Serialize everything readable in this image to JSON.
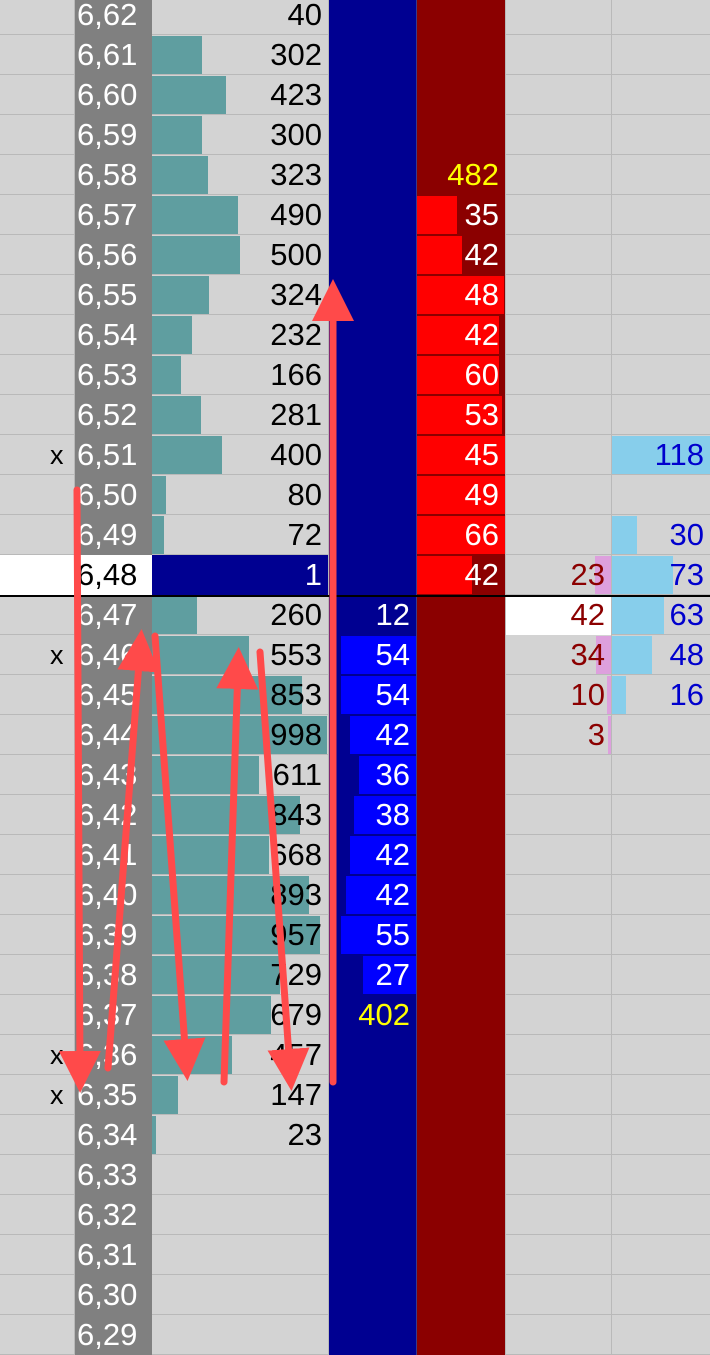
{
  "colors": {
    "sheet_bg": "#d3d3d3",
    "price_bg": "#808080",
    "volume_bar": "#5f9ea0",
    "bid_bg": "#000091",
    "bid_bar": "#0000ff",
    "ask_bg": "#8b0000",
    "ask_bar": "#ff0000",
    "highlight_text": "#ffff00",
    "delta_sell_text": "#8b0000",
    "delta_sell_bar": "#dda0dd",
    "delta_buy_text": "#0000cd",
    "delta_buy_bar": "#87ceeb",
    "arrow": "#ff4a4a"
  },
  "ladder": {
    "rows": [
      {
        "price": "6,62",
        "volume": "40",
        "volume_level": 0.0,
        "bid": "",
        "ask": "",
        "sell_delta": "",
        "buy_delta": ""
      },
      {
        "price": "6,61",
        "volume": "302",
        "volume_level": 0.05
      },
      {
        "price": "6,60",
        "volume": "423",
        "volume_level": 0.074
      },
      {
        "price": "6,59",
        "volume": "300",
        "volume_level": 0.05
      },
      {
        "price": "6,58",
        "volume": "323",
        "volume_level": 0.056,
        "ask": "482",
        "ask_highlight": true
      },
      {
        "price": "6,57",
        "volume": "490",
        "volume_level": 0.086,
        "ask": "35",
        "ask_level": 0.45
      },
      {
        "price": "6,56",
        "volume": "500",
        "volume_level": 0.088,
        "ask": "42",
        "ask_level": 0.5
      },
      {
        "price": "6,55",
        "volume": "324",
        "volume_level": 0.057,
        "ask": "48",
        "ask_level": 0.98
      },
      {
        "price": "6,54",
        "volume": "232",
        "volume_level": 0.04,
        "ask": "42",
        "ask_level": 0.92
      },
      {
        "price": "6,53",
        "volume": "166",
        "volume_level": 0.029,
        "ask": "60",
        "ask_level": 0.92
      },
      {
        "price": "6,52",
        "volume": "281",
        "volume_level": 0.049,
        "ask": "53",
        "ask_level": 0.95
      },
      {
        "price": "6,51",
        "volume": "400",
        "volume_level": 0.07,
        "ask": "45",
        "ask_level": 1.0,
        "marker": "x",
        "buy_delta": "118",
        "buy_level": 1.0
      },
      {
        "price": "6,50",
        "volume": "80",
        "volume_level": 0.014,
        "ask": "49",
        "ask_level": 1.0
      },
      {
        "price": "6,49",
        "volume": "72",
        "volume_level": 0.012,
        "ask": "66",
        "ask_level": 1.0,
        "buy_delta": "30",
        "buy_level": 0.25
      },
      {
        "price": "6,48",
        "volume": "1",
        "volume_level": 0.0,
        "ask": "42",
        "ask_level": 0.62,
        "current": true,
        "sell_delta": "23",
        "sell_level": 0.15,
        "buy_delta": "73",
        "buy_level": 0.62
      },
      {
        "price": "6,47",
        "volume": "260",
        "volume_level": 0.045,
        "bid": "12",
        "bid_level": 0.0,
        "sell_delta": "42",
        "sell_level": 0.0,
        "sell_white": true,
        "buy_delta": "63",
        "buy_level": 0.53
      },
      {
        "price": "6,46",
        "volume": "553",
        "volume_level": 0.097,
        "bid": "54",
        "bid_level": 0.85,
        "marker": "x",
        "sell_delta": "34",
        "sell_level": 0.14,
        "buy_delta": "48",
        "buy_level": 0.41
      },
      {
        "price": "6,45",
        "volume": "853",
        "volume_level": 0.15,
        "bid": "54",
        "bid_level": 0.85,
        "sell_delta": "10",
        "sell_level": 0.04,
        "buy_delta": "16",
        "buy_level": 0.14
      },
      {
        "price": "6,44",
        "volume": "998",
        "volume_level": 0.175,
        "bid": "42",
        "bid_level": 0.75,
        "sell_delta": "3",
        "sell_level": 0.03
      },
      {
        "price": "6,43",
        "volume": "611",
        "volume_level": 0.107,
        "bid": "36",
        "bid_level": 0.65
      },
      {
        "price": "6,42",
        "volume": "843",
        "volume_level": 0.148,
        "bid": "38",
        "bid_level": 0.7
      },
      {
        "price": "6,41",
        "volume": "668",
        "volume_level": 0.117,
        "bid": "42",
        "bid_level": 0.75
      },
      {
        "price": "6,40",
        "volume": "893",
        "volume_level": 0.157,
        "bid": "42",
        "bid_level": 0.8
      },
      {
        "price": "6,39",
        "volume": "957",
        "volume_level": 0.168,
        "bid": "55",
        "bid_level": 0.85
      },
      {
        "price": "6,38",
        "volume": "729",
        "volume_level": 0.128,
        "bid": "27",
        "bid_level": 0.6
      },
      {
        "price": "6,37",
        "volume": "679",
        "volume_level": 0.119,
        "bid": "402",
        "bid_highlight": true
      },
      {
        "price": "6,36",
        "volume": "457",
        "volume_level": 0.08,
        "marker": "x"
      },
      {
        "price": "6,35",
        "volume": "147",
        "volume_level": 0.026,
        "marker": "x"
      },
      {
        "price": "6,34",
        "volume": "23",
        "volume_level": 0.004
      },
      {
        "price": "6,33",
        "volume": ""
      },
      {
        "price": "6,32",
        "volume": ""
      },
      {
        "price": "6,31",
        "volume": ""
      },
      {
        "price": "6,30",
        "volume": ""
      },
      {
        "price": "6,29",
        "volume": ""
      }
    ]
  }
}
